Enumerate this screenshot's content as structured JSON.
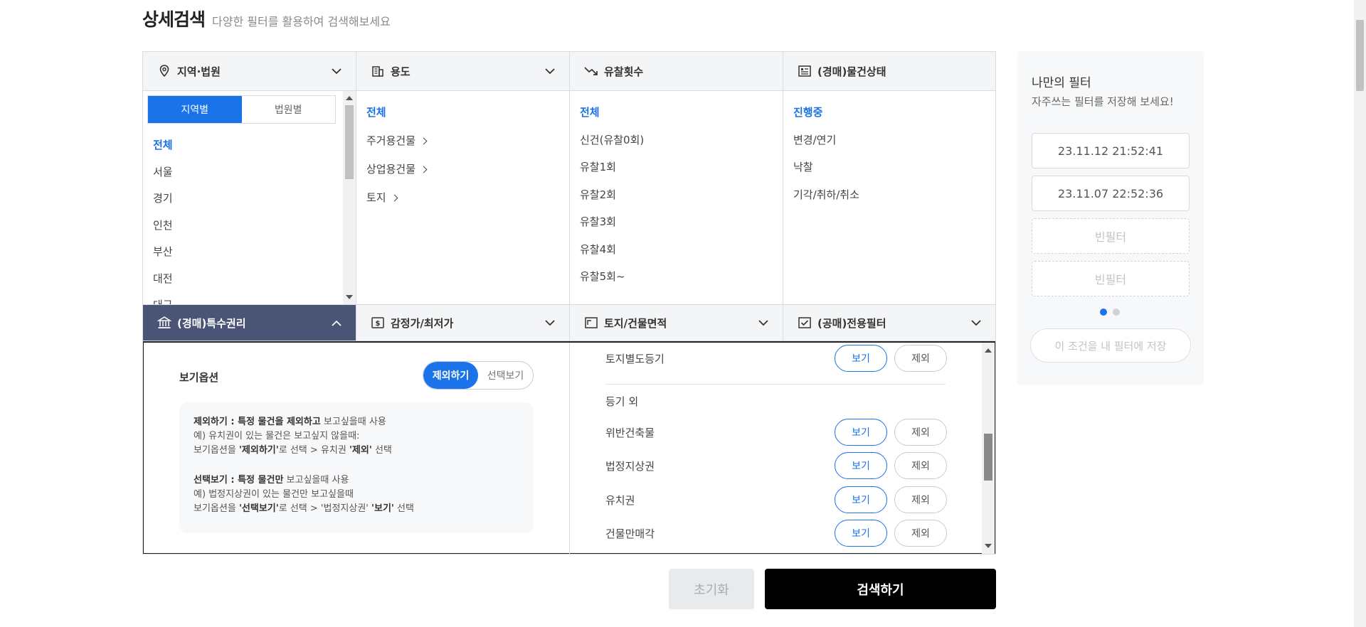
{
  "page": {
    "title": "상세검색",
    "subtitle": "다양한 필터를 활용하여 검색해보세요"
  },
  "headers": {
    "region": "지역·법원",
    "usage": "용도",
    "failed_bids": "유찰횟수",
    "auction_status": "(경매)물건상태",
    "special_rights": "(경매)특수권리",
    "appraisal": "감정가/최저가",
    "area": "토지/건물면적",
    "public_sale": "(공매)전용필터"
  },
  "region": {
    "tabs": [
      "지역별",
      "법원별"
    ],
    "items": [
      "전체",
      "서울",
      "경기",
      "인천",
      "부산",
      "대전",
      "대구"
    ]
  },
  "usage": {
    "items": [
      "전체",
      "주거용건물",
      "상업용건물",
      "토지"
    ]
  },
  "failed_bids": {
    "items": [
      "전체",
      "신건(유찰0회)",
      "유찰1회",
      "유찰2회",
      "유찰3회",
      "유찰4회",
      "유찰5회~"
    ]
  },
  "auction_status": {
    "items": [
      "진행중",
      "변경/연기",
      "낙찰",
      "기각/취하/취소"
    ]
  },
  "special_rights_panel": {
    "view_option_label": "보기옵션",
    "toggle": [
      "제외하기",
      "선택보기"
    ],
    "info": {
      "line1_bold": "제외하기 : 특정 물건을 제외하고",
      "line1_rest": " 보고싶을때 사용",
      "line2": "예) 유치권이 있는 물건은 보고싶지 않을때:",
      "line3_a": "보기옵션을 ",
      "line3_b": "'제외하기'",
      "line3_c": "로 선택 > 유치권 ",
      "line3_d": "'제외'",
      "line3_e": " 선택",
      "line4_bold": "선택보기 : 특정 물건만",
      "line4_rest": " 보고싶을때 사용",
      "line5": "예) 법정지상권이 있는 물건만 보고싶을때",
      "line6_a": "보기옵션을 ",
      "line6_b": "'선택보기'",
      "line6_c": "로 선택 > '법정지상권' ",
      "line6_d": "'보기'",
      "line6_e": " 선택"
    },
    "see_label": "보기",
    "exclude_label": "제외",
    "section_other": "등기 외",
    "rows": [
      "토지별도등기",
      "위반건축물",
      "법정지상권",
      "유치권",
      "건물만매각"
    ]
  },
  "actions": {
    "reset": "초기화",
    "search": "검색하기"
  },
  "my_filter": {
    "title": "나만의 필터",
    "subtitle": "자주쓰는 필터를 저장해 보세요!",
    "slots": [
      "23.11.12 21:52:41",
      "23.11.07 22:52:36",
      "빈필터",
      "빈필터"
    ],
    "save_label": "이 조건을 내 필터에 저장"
  },
  "colors": {
    "accent": "#1a73e8",
    "dark_header": "#4a5575",
    "search_button": "#000000"
  }
}
